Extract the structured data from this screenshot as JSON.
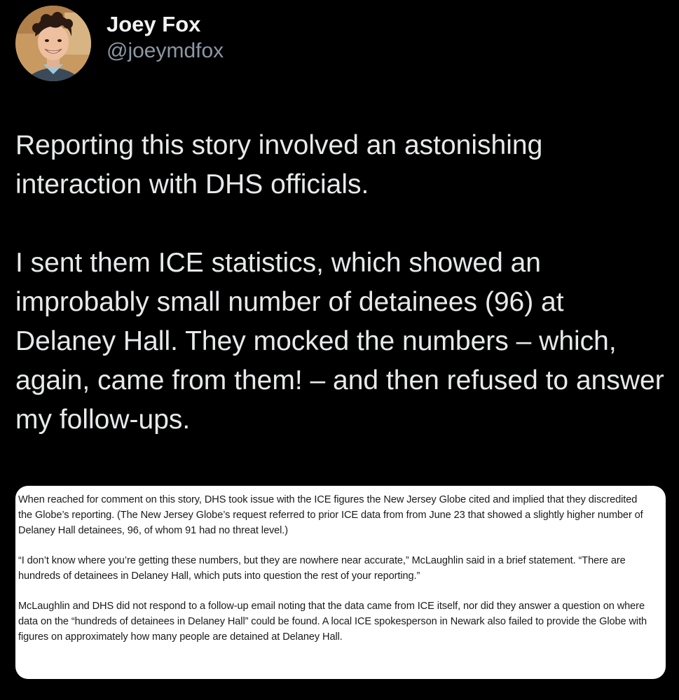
{
  "author": {
    "display_name": "Joey Fox",
    "handle": "@joeymdfox",
    "avatar_icon": "profile-photo"
  },
  "tweet": {
    "paragraphs": [
      "Reporting this story involved an astonishing interaction with DHS officials.",
      "I sent them ICE statistics, which showed an improbably small number of detainees (96) at Delaney Hall. They mocked the numbers – which, again, came from them! – and then refused to answer my follow-ups."
    ]
  },
  "attachment": {
    "paragraphs": [
      "When reached for comment on this story, DHS took issue with the ICE figures the New Jersey Globe cited and implied that they discredited the Globe’s reporting. (The New Jersey Globe’s request referred to prior ICE data from from June 23 that showed a slightly higher number of Delaney Hall detainees, 96, of whom 91 had no threat level.)",
      "“I don’t know where you’re getting these numbers, but they are nowhere near accurate,” McLaughlin said in a brief statement. “There are hundreds of detainees in Delaney Hall, which puts into question the rest of your reporting.”",
      "McLaughlin and DHS did not respond to a follow-up email noting that the data came from ICE itself, nor did they answer a question on where data on the “hundreds of detainees in Delaney Hall” could be found. A local ICE spokesperson in Newark also failed to provide the Globe with figures on approximately how many people are detained at Delaney Hall."
    ]
  },
  "colors": {
    "background": "#000000",
    "primary_text": "#e7e9ea",
    "secondary_text": "#8b98a5",
    "card_background": "#ffffff"
  }
}
